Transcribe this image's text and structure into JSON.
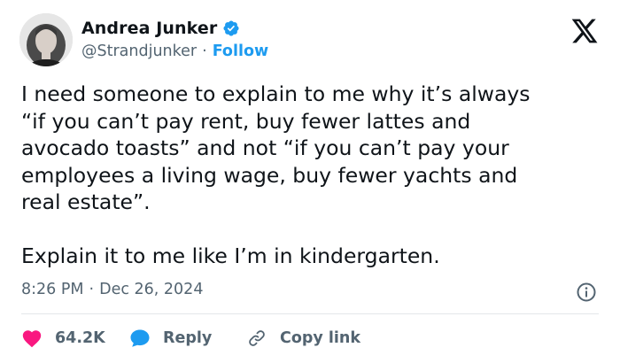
{
  "author": {
    "display_name": "Andrea Junker",
    "handle": "@Strandjunker",
    "separator": "·",
    "follow_label": "Follow"
  },
  "tweet": {
    "text": "I need someone to explain to me why it’s always\n“if you can’t pay rent, buy fewer lattes and\navocado toasts” and not “if you can’t pay your\nemployees a living wage, buy fewer yachts and\nreal estate”.\n\nExplain it to me like I’m in kindergarten."
  },
  "meta": {
    "time": "8:26 PM",
    "separator": "·",
    "date": "Dec 26, 2024"
  },
  "actions": {
    "like_count": "64.2K",
    "reply_label": "Reply",
    "copy_link_label": "Copy link"
  },
  "colors": {
    "accent": "#1d9bf0",
    "like": "#f91880",
    "text": "#0f1419",
    "secondary": "#536471"
  },
  "icons": [
    "avatar-photo",
    "verified-badge-icon",
    "x-logo-icon",
    "info-icon",
    "heart-icon",
    "reply-bubble-icon",
    "link-icon"
  ]
}
